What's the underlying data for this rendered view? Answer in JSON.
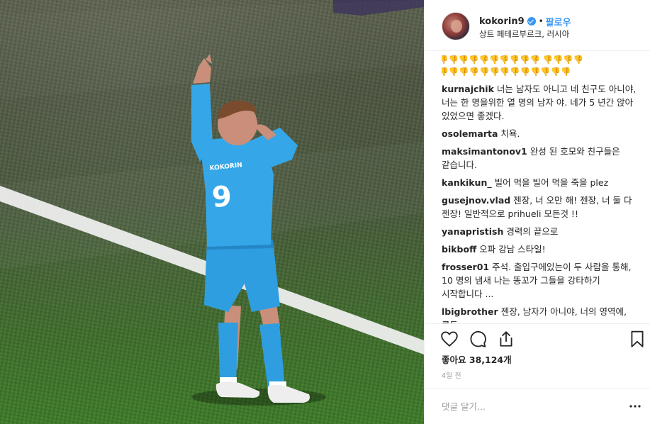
{
  "post": {
    "username": "kokorin9",
    "verified": true,
    "separator": "•",
    "follow_label": "팔로우",
    "location": "상트 페테르부르크, 러시아",
    "caption_emoji_rows": [
      "👎👎👎👎👎👎👎👎👎👎 👎👎👎👎",
      "👎👎👎👎👎👎👎👎👎👎👎👎👎"
    ],
    "comments": [
      {
        "author": "kurnajchik",
        "text": "너는 남자도 아니고 네 친구도 아니야, 너는 한 명을위한 열 명의 남자 야. 네가 5 년간 앉아 있었으면 좋겠다."
      },
      {
        "author": "osolemarta",
        "text": "치욕."
      },
      {
        "author": "maksimantonov1",
        "text": "완성 된 호모와 친구들은 같습니다."
      },
      {
        "author": "kankikun_",
        "text": "빌어 먹을 빌어 먹을 죽을 plez"
      },
      {
        "author": "gusejnov.vlad",
        "text": "젠장, 너 오만 해! 젠장, 너 둘 다 젠장! 일반적으로 prihueli 모든것 !!"
      },
      {
        "author": "yanapristish",
        "text": "경력의 끝으로"
      },
      {
        "author": "bikboff",
        "text": "오파 강남 스타일!"
      },
      {
        "author": "frosser01",
        "text": "주석. 출입구에있는이 두 사람을 통해, 10 명의 냄새 나는 똥꼬가 그들을 강타하기 시작합니다 ..."
      },
      {
        "author": "lbigbrother",
        "text": "젠장, 남자가 아니야, 너의 영역에, 콘돔"
      }
    ],
    "likes_label": "좋아요",
    "likes_count": "38,124개",
    "timestamp": "4일 전",
    "comment_placeholder": "댓글 달기...",
    "icons": [
      "heart-icon",
      "comment-icon",
      "share-icon",
      "bookmark-icon",
      "more-options-icon"
    ],
    "photo": {
      "jersey_number": "9",
      "jersey_name": "KOKORIN",
      "colors": {
        "kit": "#2f9ee0",
        "grass": "#3f6a2c",
        "line": "#f2f2f2"
      }
    },
    "colors": {
      "link": "#3897f0",
      "text": "#262626",
      "muted": "#999999",
      "border": "#efefef"
    }
  }
}
